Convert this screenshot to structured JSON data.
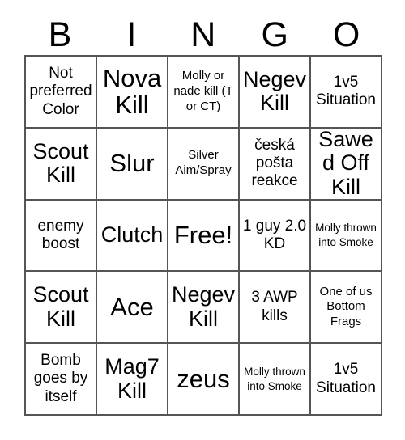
{
  "card": {
    "headers": [
      "B",
      "I",
      "N",
      "G",
      "O"
    ],
    "rows": [
      [
        {
          "text": "Not preferred Color",
          "size": "md"
        },
        {
          "text": "Nova Kill",
          "size": "xl"
        },
        {
          "text": "Molly or nade kill (T or CT)",
          "size": "sm"
        },
        {
          "text": "Negev Kill",
          "size": "lg"
        },
        {
          "text": "1v5 Situation",
          "size": "md"
        }
      ],
      [
        {
          "text": "Scout Kill",
          "size": "lg"
        },
        {
          "text": "Slur",
          "size": "xl"
        },
        {
          "text": "Silver Aim/Spray",
          "size": "sm"
        },
        {
          "text": "česká pošta reakce",
          "size": "md"
        },
        {
          "text": "Sawed Off Kill",
          "size": "lg"
        }
      ],
      [
        {
          "text": "enemy boost",
          "size": "md"
        },
        {
          "text": "Clutch",
          "size": "lg"
        },
        {
          "text": "Free!",
          "size": "xl"
        },
        {
          "text": "1 guy 2.0 KD",
          "size": "md"
        },
        {
          "text": "Molly thrown into Smoke",
          "size": "xs"
        }
      ],
      [
        {
          "text": "Scout Kill",
          "size": "lg"
        },
        {
          "text": "Ace",
          "size": "xl"
        },
        {
          "text": "Negev Kill",
          "size": "lg"
        },
        {
          "text": "3 AWP kills",
          "size": "md"
        },
        {
          "text": "One of us Bottom Frags",
          "size": "sm"
        }
      ],
      [
        {
          "text": "Bomb goes by itself",
          "size": "md"
        },
        {
          "text": "Mag7 Kill",
          "size": "lg"
        },
        {
          "text": "zeus",
          "size": "xl"
        },
        {
          "text": "Molly thrown into Smoke",
          "size": "xs"
        },
        {
          "text": "1v5 Situation",
          "size": "md"
        }
      ]
    ]
  }
}
